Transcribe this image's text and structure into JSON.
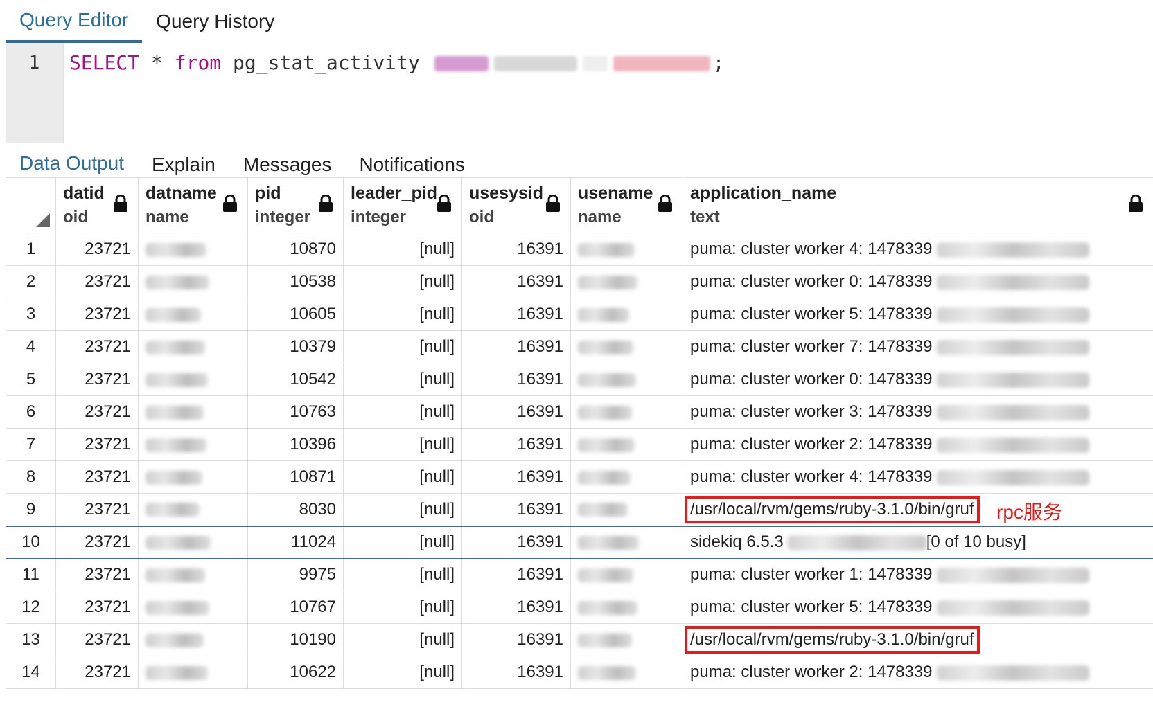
{
  "editor_tabs": [
    {
      "label": "Query Editor",
      "active": true
    },
    {
      "label": "Query History",
      "active": false
    }
  ],
  "editor": {
    "line_number": "1",
    "keyword_select": "SELECT",
    "star": "*",
    "keyword_from": "from",
    "table": "pg_stat_activity",
    "terminator": ";"
  },
  "output_tabs": [
    {
      "label": "Data Output",
      "active": true
    },
    {
      "label": "Explain",
      "active": false
    },
    {
      "label": "Messages",
      "active": false
    },
    {
      "label": "Notifications",
      "active": false
    }
  ],
  "columns": [
    {
      "name": "datid",
      "type": "oid"
    },
    {
      "name": "datname",
      "type": "name"
    },
    {
      "name": "pid",
      "type": "integer"
    },
    {
      "name": "leader_pid",
      "type": "integer"
    },
    {
      "name": "usesysid",
      "type": "oid"
    },
    {
      "name": "usename",
      "type": "name"
    },
    {
      "name": "application_name",
      "type": "text"
    }
  ],
  "rows": [
    {
      "n": "1",
      "datid": "23721",
      "pid": "10870",
      "leader_pid": "[null]",
      "usesysid": "16391",
      "app": "puma: cluster worker 4: 1478339",
      "highlight": false
    },
    {
      "n": "2",
      "datid": "23721",
      "pid": "10538",
      "leader_pid": "[null]",
      "usesysid": "16391",
      "app": "puma: cluster worker 0: 1478339",
      "highlight": false
    },
    {
      "n": "3",
      "datid": "23721",
      "pid": "10605",
      "leader_pid": "[null]",
      "usesysid": "16391",
      "app": "puma: cluster worker 5: 1478339",
      "highlight": false
    },
    {
      "n": "4",
      "datid": "23721",
      "pid": "10379",
      "leader_pid": "[null]",
      "usesysid": "16391",
      "app": "puma: cluster worker 7: 1478339",
      "highlight": false
    },
    {
      "n": "5",
      "datid": "23721",
      "pid": "10542",
      "leader_pid": "[null]",
      "usesysid": "16391",
      "app": "puma: cluster worker 0: 1478339",
      "highlight": false
    },
    {
      "n": "6",
      "datid": "23721",
      "pid": "10763",
      "leader_pid": "[null]",
      "usesysid": "16391",
      "app": "puma: cluster worker 3: 1478339",
      "highlight": false
    },
    {
      "n": "7",
      "datid": "23721",
      "pid": "10396",
      "leader_pid": "[null]",
      "usesysid": "16391",
      "app": "puma: cluster worker 2: 1478339",
      "highlight": false
    },
    {
      "n": "8",
      "datid": "23721",
      "pid": "10871",
      "leader_pid": "[null]",
      "usesysid": "16391",
      "app": "puma: cluster worker 4: 1478339",
      "highlight": false
    },
    {
      "n": "9",
      "datid": "23721",
      "pid": "8030",
      "leader_pid": "[null]",
      "usesysid": "16391",
      "app": "/usr/local/rvm/gems/ruby-3.1.0/bin/gruf",
      "highlight": true
    },
    {
      "n": "10",
      "datid": "23721",
      "pid": "11024",
      "leader_pid": "[null]",
      "usesysid": "16391",
      "app": "sidekiq 6.5.3",
      "app_suffix": "[0 of 10 busy]",
      "highlight": false,
      "selected": true
    },
    {
      "n": "11",
      "datid": "23721",
      "pid": "9975",
      "leader_pid": "[null]",
      "usesysid": "16391",
      "app": "puma: cluster worker 1: 1478339",
      "highlight": false
    },
    {
      "n": "12",
      "datid": "23721",
      "pid": "10767",
      "leader_pid": "[null]",
      "usesysid": "16391",
      "app": "puma: cluster worker 5: 1478339",
      "highlight": false
    },
    {
      "n": "13",
      "datid": "23721",
      "pid": "10190",
      "leader_pid": "[null]",
      "usesysid": "16391",
      "app": "/usr/local/rvm/gems/ruby-3.1.0/bin/gruf",
      "highlight": true
    },
    {
      "n": "14",
      "datid": "23721",
      "pid": "10622",
      "leader_pid": "[null]",
      "usesysid": "16391",
      "app": "puma: cluster worker 2: 1478339",
      "highlight": false
    }
  ],
  "annotation": "rpc服务",
  "colors": {
    "accent": "#2a6fa0",
    "keyword": "#a0158a",
    "highlight": "#e21b1b"
  },
  "icons": [
    "lock-icon",
    "sort-corner-icon"
  ]
}
